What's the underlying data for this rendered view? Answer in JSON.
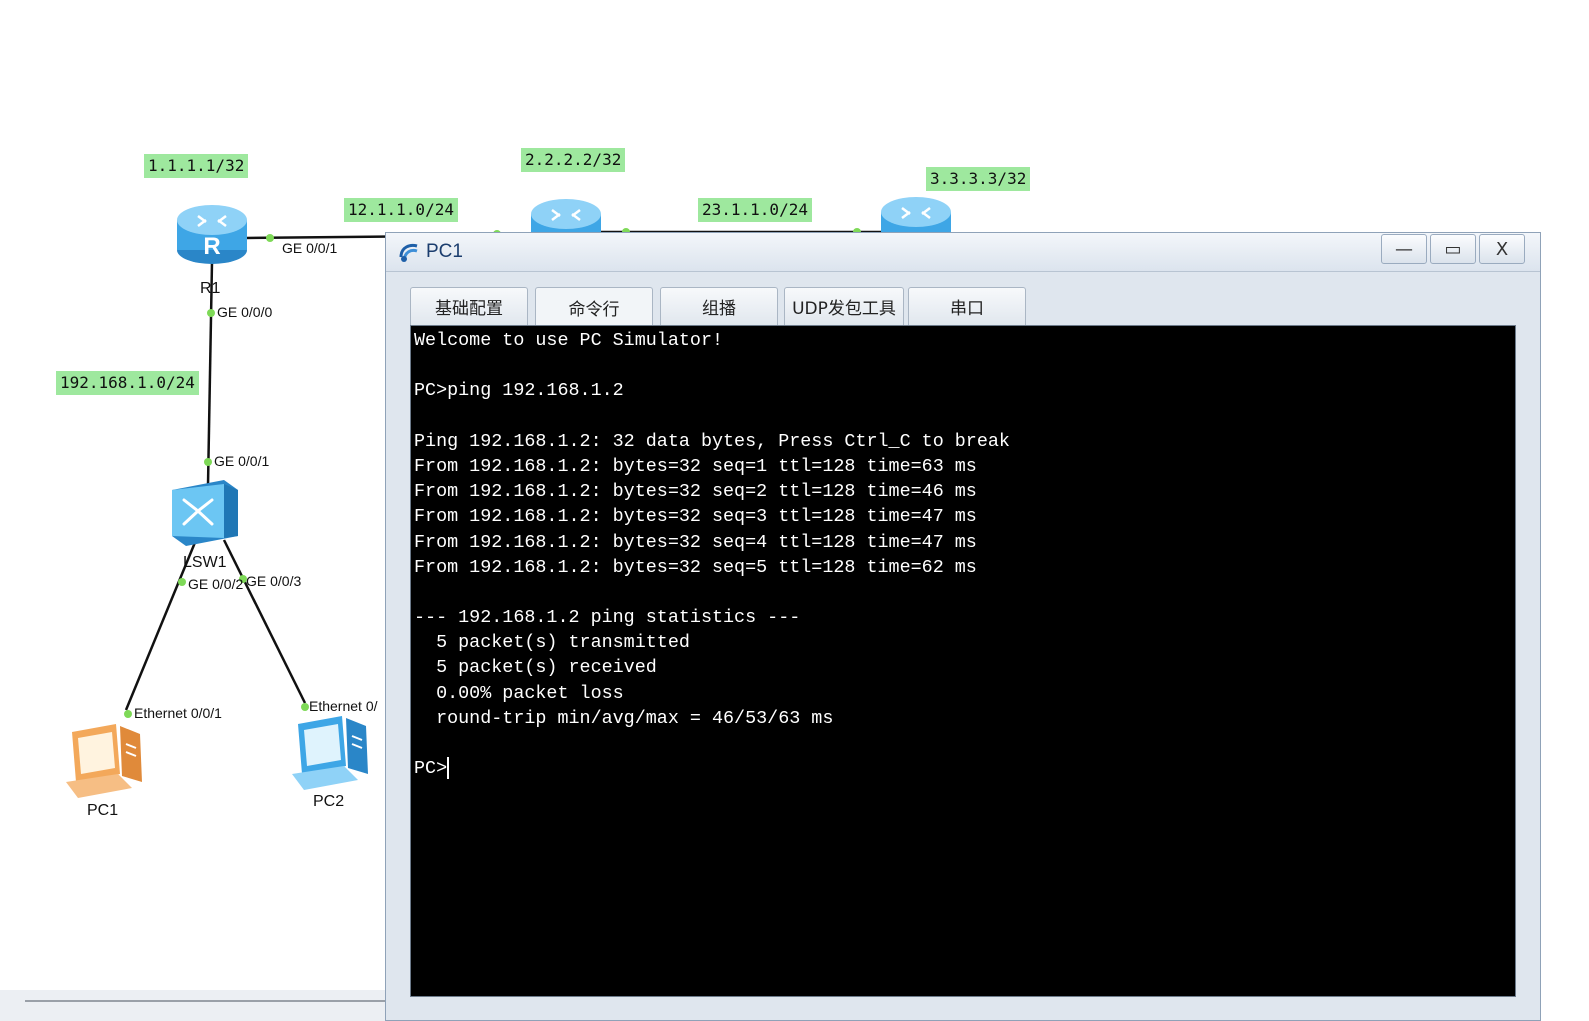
{
  "topology": {
    "labels": {
      "r1_loopback": "1.1.1.1/32",
      "r2_loopback": "2.2.2.2/32",
      "r3_loopback": "3.3.3.3/32",
      "net_12": "12.1.1.0/24",
      "net_23": "23.1.1.0/24",
      "net_lan": "192.168.1.0/24"
    },
    "ports": {
      "r1_ge001": "GE 0/0/1",
      "r1_ge000": "GE 0/0/0",
      "lsw1_ge001": "GE 0/0/1",
      "lsw1_ge002": "GE 0/0/2",
      "lsw1_ge003": "GE 0/0/3",
      "pc1_eth": "Ethernet 0/0/1",
      "pc2_eth": "Ethernet 0/"
    },
    "devices": {
      "r1": "R1",
      "router_glyph": "R",
      "lsw1": "LSW1",
      "pc1": "PC1",
      "pc2": "PC2"
    },
    "colors": {
      "label_bg": "#9ee89e",
      "port_dot": "#7ed957",
      "router_blue": "#3ea6e6"
    }
  },
  "window": {
    "title": "PC1",
    "controls": {
      "minimize": "—",
      "maximize": "▭",
      "close": "X"
    },
    "tabs": [
      {
        "label": "基础配置"
      },
      {
        "label": "命令行"
      },
      {
        "label": "组播"
      },
      {
        "label": "UDP发包工具"
      },
      {
        "label": "串口"
      }
    ],
    "active_tab": "命令行"
  },
  "terminal": {
    "lines": [
      "Welcome to use PC Simulator!",
      "",
      "PC>ping 192.168.1.2",
      "",
      "Ping 192.168.1.2: 32 data bytes, Press Ctrl_C to break",
      "From 192.168.1.2: bytes=32 seq=1 ttl=128 time=63 ms",
      "From 192.168.1.2: bytes=32 seq=2 ttl=128 time=46 ms",
      "From 192.168.1.2: bytes=32 seq=3 ttl=128 time=47 ms",
      "From 192.168.1.2: bytes=32 seq=4 ttl=128 time=47 ms",
      "From 192.168.1.2: bytes=32 seq=5 ttl=128 time=62 ms",
      "",
      "--- 192.168.1.2 ping statistics ---",
      "  5 packet(s) transmitted",
      "  5 packet(s) received",
      "  0.00% packet loss",
      "  round-trip min/avg/max = 46/53/63 ms",
      ""
    ],
    "prompt": "PC>"
  }
}
